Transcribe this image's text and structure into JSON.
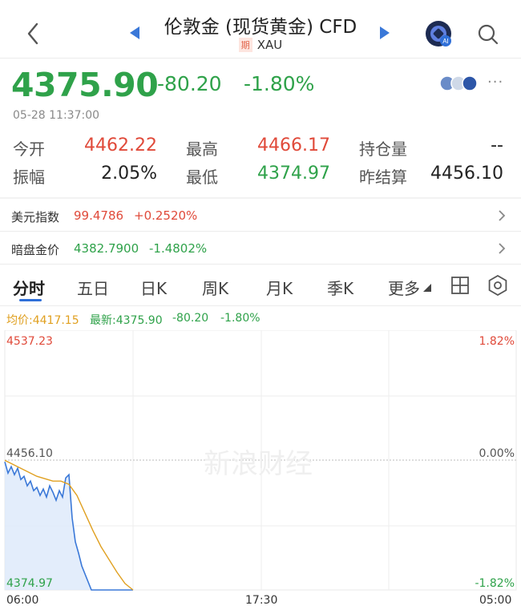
{
  "header": {
    "title": "伦敦金 (现货黄金) CFD",
    "badge": "期",
    "symbol": "XAU",
    "ai_badge": "AI",
    "back_icon": "chevron-left-icon",
    "search_icon": "search-icon"
  },
  "quote": {
    "price": "4375.90",
    "change": "-80.20",
    "change_pct": "-1.80%",
    "time": "05-28 11:37:00",
    "more": "···"
  },
  "stats": {
    "open_label": "今开",
    "open": "4462.22",
    "high_label": "最高",
    "high": "4466.17",
    "oi_label": "持仓量",
    "oi": "--",
    "amp_label": "振幅",
    "amp": "2.05%",
    "low_label": "最低",
    "low": "4374.97",
    "prev_label": "昨结算",
    "prev": "4456.10"
  },
  "related": {
    "usd_label": "美元指数",
    "usd_value": "99.4786",
    "usd_change": "+0.2520%",
    "dark_label": "暗盘金价",
    "dark_value": "4382.7900",
    "dark_change": "-1.4802%"
  },
  "tabs": [
    "分时",
    "五日",
    "日K",
    "周K",
    "月K",
    "季K",
    "更多"
  ],
  "legend": {
    "avg": "均价:4417.15",
    "latest": "最新:4375.90",
    "change": "-80.20",
    "pct": "-1.80%"
  },
  "chart_labels": {
    "top_price": "4537.23",
    "mid_price": "4456.10",
    "bottom_price": "4374.97",
    "top_pct": "1.82%",
    "mid_pct": "0.00%",
    "bottom_pct": "-1.82%",
    "time_start": "06:00",
    "time_mid": "17:30",
    "time_end": "05:00",
    "watermark": "新浪财经"
  },
  "colors": {
    "up": "#e04a3a",
    "down": "#2fa24a",
    "price_line": "#3a78d8",
    "avg_line": "#e0a020",
    "accent": "#2f6fd8"
  },
  "chart_data": {
    "type": "line",
    "title": "",
    "xlabel": "",
    "ylabel": "",
    "ylim": [
      4374.97,
      4537.23
    ],
    "reference": 4456.1,
    "x_ticks": [
      "06:00",
      "17:30",
      "05:00"
    ],
    "series": [
      {
        "name": "最新",
        "color": "#3a78d8",
        "x": [
          0,
          4,
          8,
          12,
          16,
          20,
          24,
          28,
          32,
          36,
          40,
          44,
          48,
          52,
          56,
          60,
          64,
          68,
          72,
          76,
          80,
          84,
          88,
          92,
          96,
          100,
          104,
          108,
          112,
          116,
          120,
          124,
          128,
          132,
          136,
          140,
          144,
          148,
          152,
          156,
          160
        ],
        "values": [
          4455,
          4448,
          4452,
          4447,
          4451,
          4444,
          4446,
          4440,
          4443,
          4437,
          4439,
          4434,
          4438,
          4433,
          4440,
          4436,
          4431,
          4437,
          4433,
          4445,
          4447,
          4420,
          4405,
          4398,
          4390,
          4385,
          4380,
          4372,
          4365,
          4372,
          4362,
          4366,
          4355,
          4350,
          4348,
          4340,
          4338,
          4330,
          4320,
          4312,
          4305
        ]
      },
      {
        "name": "均价",
        "color": "#e0a020",
        "x": [
          0,
          20,
          40,
          60,
          70,
          80,
          90,
          100,
          110,
          120,
          130,
          140,
          150,
          160
        ],
        "values": [
          4456,
          4451,
          4446,
          4443,
          4443,
          4441,
          4434,
          4423,
          4412,
          4402,
          4394,
          4386,
          4379,
          4373
        ]
      }
    ]
  }
}
